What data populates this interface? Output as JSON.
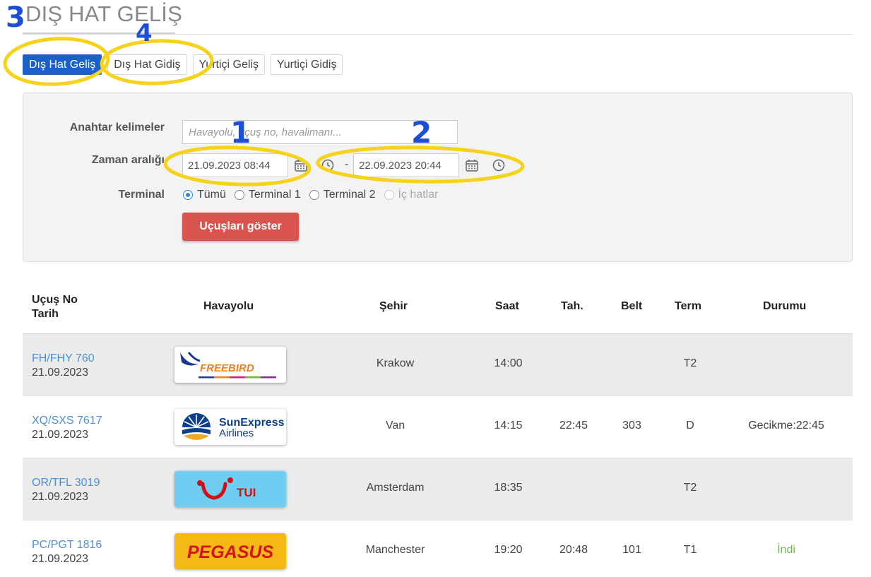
{
  "page": {
    "title": "DIŞ HAT GELİŞ"
  },
  "tabs": [
    {
      "label": "Dış Hat Geliş",
      "active": true
    },
    {
      "label": "Dış Hat Gidiş",
      "active": false
    },
    {
      "label": "Yurtiçi Geliş",
      "active": false
    },
    {
      "label": "Yurtiçi Gidiş",
      "active": false
    }
  ],
  "filter": {
    "keywords_label": "Anahtar kelimeler",
    "keywords_placeholder": "Havayolu, uçuş no, havalimanı...",
    "keywords_value": "",
    "range_label": "Zaman aralığı",
    "start_datetime": "21.09.2023 08:44",
    "end_datetime": "22.09.2023 20:44",
    "range_separator": "-",
    "terminal_label": "Terminal",
    "terminal_options": [
      "Tümü",
      "Terminal 1",
      "Terminal 2",
      "İç hatlar"
    ],
    "terminal_selected": "Tümü",
    "submit_label": "Uçuşları göster"
  },
  "table": {
    "headers": {
      "flight_no": "Uçuş No",
      "date": "Tarih",
      "airline": "Havayolu",
      "city": "Şehir",
      "time": "Saat",
      "estimated": "Tah.",
      "belt": "Belt",
      "terminal": "Term",
      "status": "Durumu"
    },
    "rows": [
      {
        "flight_no": "FH/FHY 760",
        "date": "21.09.2023",
        "airline_logo": "freebird-logo",
        "airline_text": "FREEBIRD",
        "city": "Krakow",
        "time": "14:00",
        "estimated": "",
        "belt": "",
        "terminal": "T2",
        "status": ""
      },
      {
        "flight_no": "XQ/SXS 7617",
        "date": "21.09.2023",
        "airline_logo": "sunexpress-logo",
        "airline_text": "SunExpress Airlines",
        "city": "Van",
        "time": "14:15",
        "estimated": "22:45",
        "belt": "303",
        "terminal": "D",
        "status": "Gecikme:22:45"
      },
      {
        "flight_no": "OR/TFL 3019",
        "date": "21.09.2023",
        "airline_logo": "tui-logo",
        "airline_text": "TUI",
        "city": "Amsterdam",
        "time": "18:35",
        "estimated": "",
        "belt": "",
        "terminal": "T2",
        "status": ""
      },
      {
        "flight_no": "PC/PGT 1816",
        "date": "21.09.2023",
        "airline_logo": "pegasus-logo",
        "airline_text": "PEGASUS",
        "city": "Manchester",
        "time": "19:20",
        "estimated": "20:48",
        "belt": "101",
        "terminal": "T1",
        "status": "İndi"
      }
    ]
  },
  "annotations": {
    "color": "#f6d21a",
    "number_color": "#1a4fd6",
    "labels": [
      "1",
      "2",
      "3",
      "4"
    ]
  },
  "colors": {
    "active_tab": "#1b60c9",
    "submit_button": "#d9534f",
    "flight_link": "#4a90d9",
    "landed_status": "#6fb85a"
  }
}
